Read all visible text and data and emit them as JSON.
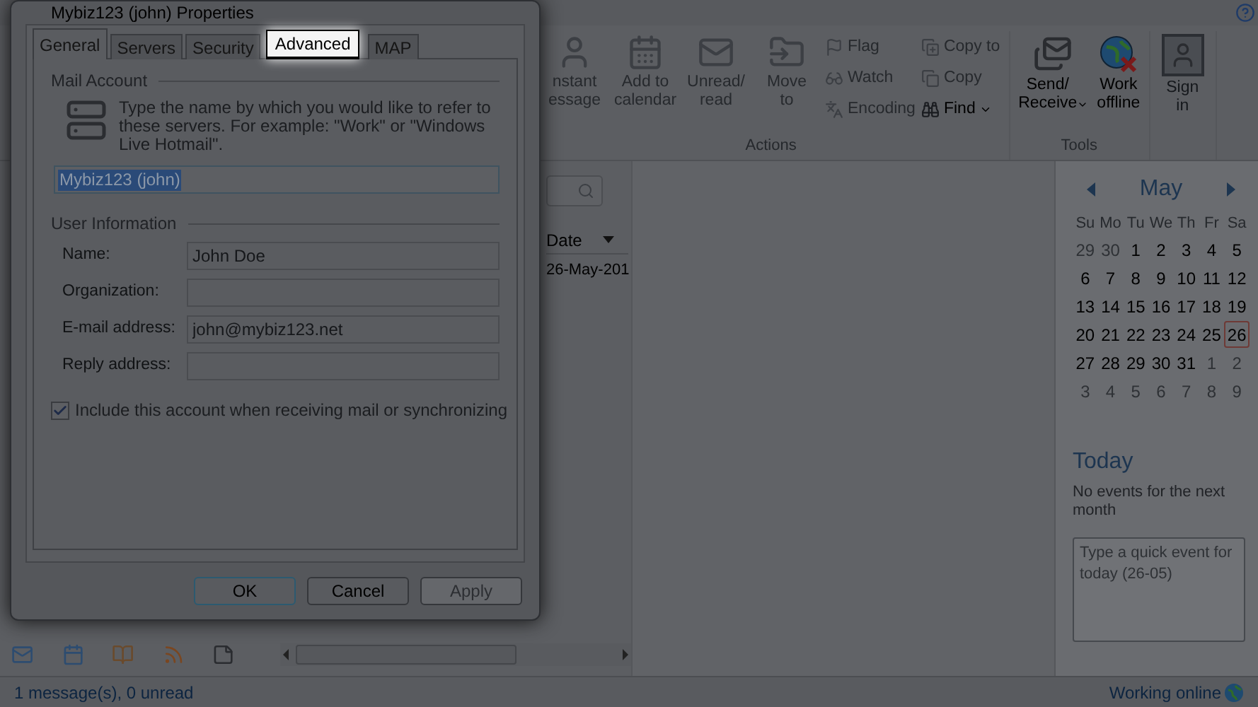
{
  "dialog": {
    "title": "Mybiz123 (john) Properties",
    "tabs": [
      {
        "label": "General",
        "selected": true,
        "highlighted": false
      },
      {
        "label": "Servers",
        "selected": false,
        "highlighted": false
      },
      {
        "label": "Security",
        "selected": false,
        "highlighted": false
      },
      {
        "label": "Advanced",
        "selected": false,
        "highlighted": true
      },
      {
        "label": "MAP",
        "selected": false,
        "highlighted": false
      }
    ],
    "mail_account": {
      "heading": "Mail Account",
      "description": "Type the name by which you would like to refer to these servers.  For example: \"Work\" or \"Windows Live Hotmail\".",
      "account_name": "Mybiz123 (john)"
    },
    "user_information": {
      "heading": "User Information",
      "fields": [
        {
          "label": "Name:",
          "value": "John Doe"
        },
        {
          "label": "Organization:"
        },
        {
          "label": "E-mail address:",
          "value": "john@mybiz123.net"
        },
        {
          "label": "Reply address:"
        }
      ]
    },
    "include_checkbox": {
      "label": "Include this account when receiving mail or synchronizing",
      "checked": true
    },
    "buttons": [
      {
        "label": "OK",
        "default": true,
        "disabled": false
      },
      {
        "label": "Cancel",
        "default": false,
        "disabled": false
      },
      {
        "label": "Apply",
        "default": false,
        "disabled": true
      }
    ]
  },
  "ribbon": {
    "large_buttons_before": [
      {
        "kind": "contact",
        "lines": [
          "nstant",
          "essage"
        ],
        "disabled": true
      },
      {
        "kind": "calendar",
        "lines": [
          "Add to",
          "calendar"
        ],
        "disabled": true
      },
      {
        "kind": "envelope",
        "lines": [
          "Unread/",
          "read"
        ],
        "disabled": true
      },
      {
        "kind": "move",
        "lines": [
          "Move",
          "to"
        ],
        "disabled": true
      }
    ],
    "small_columns": [
      [
        {
          "kind": "flag",
          "label": "Flag",
          "dropdown": false,
          "disabled": true
        },
        {
          "kind": "watch",
          "label": "Watch",
          "dropdown": false,
          "disabled": true
        },
        {
          "kind": "encoding",
          "label": "Encoding",
          "dropdown": false,
          "disabled": true
        }
      ],
      [
        {
          "kind": "copy-to",
          "label": "Copy to",
          "dropdown": false,
          "disabled": true
        },
        {
          "kind": "copy",
          "label": "Copy",
          "dropdown": false,
          "disabled": true
        },
        {
          "kind": "find",
          "label": "Find",
          "dropdown": true,
          "disabled": false
        }
      ]
    ],
    "actions_label": "Actions",
    "tools": [
      {
        "kind": "send-receive",
        "lines": [
          "Send/",
          "Receive"
        ],
        "dropdown": true,
        "disabled": false
      },
      {
        "kind": "offline",
        "lines": [
          "Work",
          "offline"
        ],
        "dropdown": false,
        "disabled": false
      }
    ],
    "tools_label": "Tools",
    "sign_in": {
      "lines": [
        "Sign",
        "in"
      ]
    }
  },
  "message_list": {
    "column": "Date",
    "row": "26-May-201"
  },
  "calendar": {
    "month": "May",
    "weekdays": [
      "Su",
      "Mo",
      "Tu",
      "We",
      "Th",
      "Fr",
      "Sa"
    ],
    "weeks": [
      [
        {
          "d": "29",
          "muted": true,
          "today": false
        },
        {
          "d": "30",
          "muted": true,
          "today": false
        },
        {
          "d": "1",
          "muted": false,
          "today": false
        },
        {
          "d": "2",
          "muted": false,
          "today": false
        },
        {
          "d": "3",
          "muted": false,
          "today": false
        },
        {
          "d": "4",
          "muted": false,
          "today": false
        },
        {
          "d": "5",
          "muted": false,
          "today": false
        }
      ],
      [
        {
          "d": "6",
          "muted": false,
          "today": false
        },
        {
          "d": "7",
          "muted": false,
          "today": false
        },
        {
          "d": "8",
          "muted": false,
          "today": false
        },
        {
          "d": "9",
          "muted": false,
          "today": false
        },
        {
          "d": "10",
          "muted": false,
          "today": false
        },
        {
          "d": "11",
          "muted": false,
          "today": false
        },
        {
          "d": "12",
          "muted": false,
          "today": false
        }
      ],
      [
        {
          "d": "13",
          "muted": false,
          "today": false
        },
        {
          "d": "14",
          "muted": false,
          "today": false
        },
        {
          "d": "15",
          "muted": false,
          "today": false
        },
        {
          "d": "16",
          "muted": false,
          "today": false
        },
        {
          "d": "17",
          "muted": false,
          "today": false
        },
        {
          "d": "18",
          "muted": false,
          "today": false
        },
        {
          "d": "19",
          "muted": false,
          "today": false
        }
      ],
      [
        {
          "d": "20",
          "muted": false,
          "today": false
        },
        {
          "d": "21",
          "muted": false,
          "today": false
        },
        {
          "d": "22",
          "muted": false,
          "today": false
        },
        {
          "d": "23",
          "muted": false,
          "today": false
        },
        {
          "d": "24",
          "muted": false,
          "today": false
        },
        {
          "d": "25",
          "muted": false,
          "today": false
        },
        {
          "d": "26",
          "muted": false,
          "today": true
        }
      ],
      [
        {
          "d": "27",
          "muted": false,
          "today": false
        },
        {
          "d": "28",
          "muted": false,
          "today": false
        },
        {
          "d": "29",
          "muted": false,
          "today": false
        },
        {
          "d": "30",
          "muted": false,
          "today": false
        },
        {
          "d": "31",
          "muted": false,
          "today": false
        },
        {
          "d": "1",
          "muted": true,
          "today": false
        },
        {
          "d": "2",
          "muted": true,
          "today": false
        }
      ],
      [
        {
          "d": "3",
          "muted": true,
          "today": false
        },
        {
          "d": "4",
          "muted": true,
          "today": false
        },
        {
          "d": "5",
          "muted": true,
          "today": false
        },
        {
          "d": "6",
          "muted": true,
          "today": false
        },
        {
          "d": "7",
          "muted": true,
          "today": false
        },
        {
          "d": "8",
          "muted": true,
          "today": false
        },
        {
          "d": "9",
          "muted": true,
          "today": false
        }
      ]
    ],
    "today_heading": "Today",
    "no_events": "No events for the next month",
    "quick_event": {
      "placeholder": "Type a quick event for today (26-05)"
    }
  },
  "status_bar": {
    "messages": "1 message(s), 0 unread",
    "connection": "Working online"
  }
}
